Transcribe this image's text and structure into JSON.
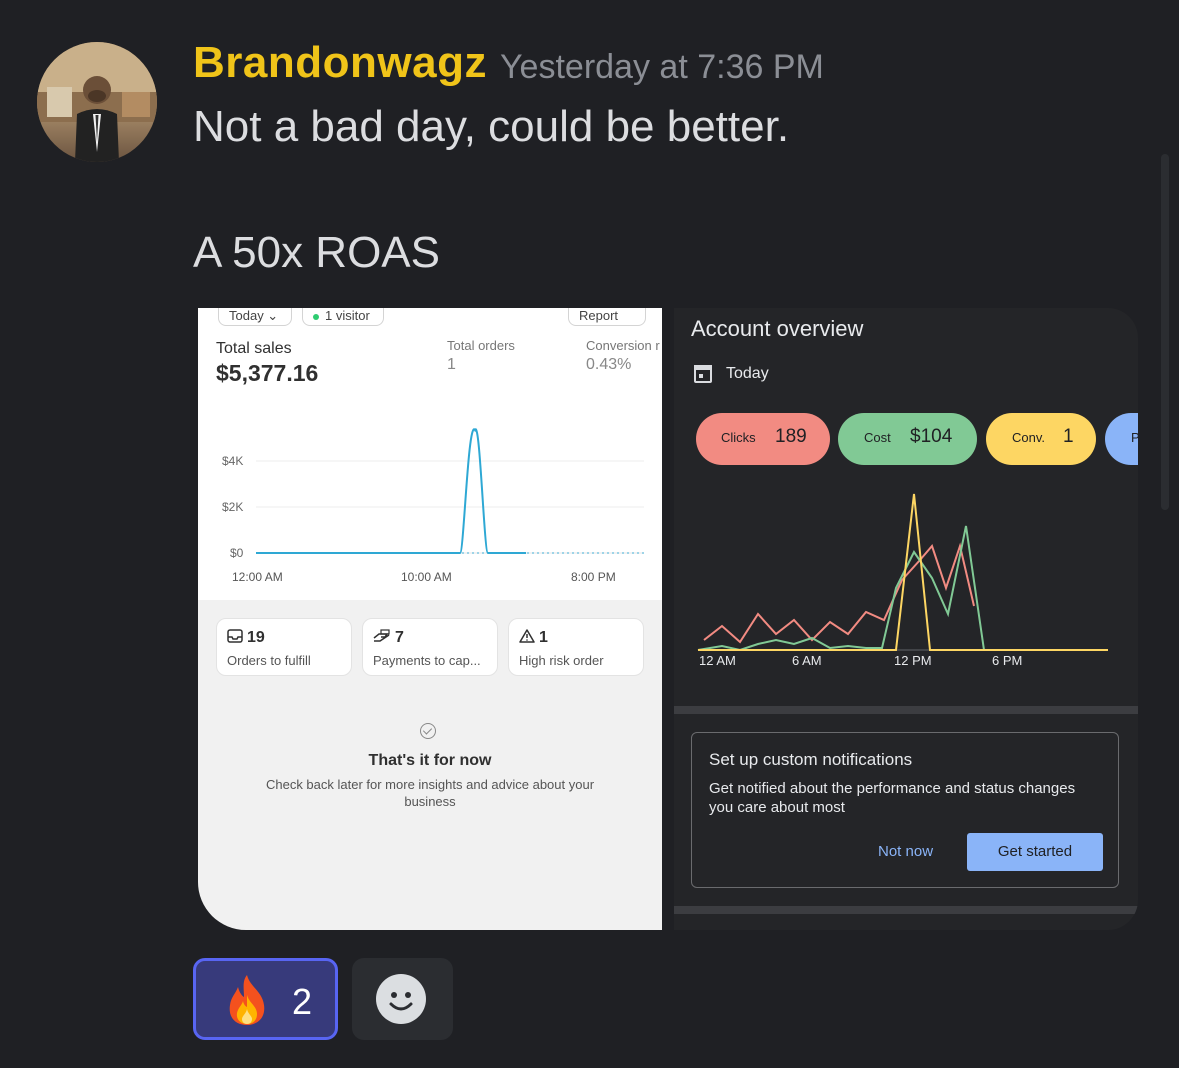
{
  "message": {
    "username": "Brandonwagz",
    "timestamp": "Yesterday at 7:36 PM",
    "line1": "Not a bad day, could be better.",
    "line2": "A 50x ROAS",
    "username_color": "#f0c419"
  },
  "shopify": {
    "date_pill": "Today ⌄",
    "visitor_pill": "1 visitor",
    "report_pill": "Report",
    "total_sales_label": "Total sales",
    "total_sales_value": "$5,377.16",
    "total_orders_label": "Total orders",
    "total_orders_value": "1",
    "conversion_label": "Conversion r",
    "conversion_value": "0.43%",
    "y_ticks": [
      "$4K",
      "$2K",
      "$0"
    ],
    "x_ticks": [
      "12:00 AM",
      "10:00 AM",
      "8:00 PM"
    ],
    "tiles": [
      {
        "icon": "inbox-icon",
        "count": "19",
        "label": "Orders to fulfill"
      },
      {
        "icon": "hand-payment-icon",
        "count": "7",
        "label": "Payments to cap..."
      },
      {
        "icon": "warning-icon",
        "count": "1",
        "label": "High risk order"
      }
    ],
    "done_title": "That's it for now",
    "done_sub": "Check back later for more insights and advice about your business",
    "line_color": "#2ea8d4"
  },
  "ads": {
    "title": "Account overview",
    "date": "Today",
    "chips": [
      {
        "label": "Clicks",
        "value": "189",
        "color": "#f28b82"
      },
      {
        "label": "Cost",
        "value": "$104",
        "color": "#81c995"
      },
      {
        "label": "Conv.",
        "value": "1",
        "color": "#fdd663"
      },
      {
        "label": "P",
        "value": "",
        "color": "#8ab4f8"
      }
    ],
    "x_ticks": [
      "12 AM",
      "6 AM",
      "12 PM",
      "6 PM"
    ],
    "notif_title": "Set up custom notifications",
    "notif_body": "Get notified about the performance and status changes you care about most",
    "not_now": "Not now",
    "get_started": "Get started"
  },
  "reactions": [
    {
      "emoji": "fire-icon",
      "count": "2"
    }
  ]
}
